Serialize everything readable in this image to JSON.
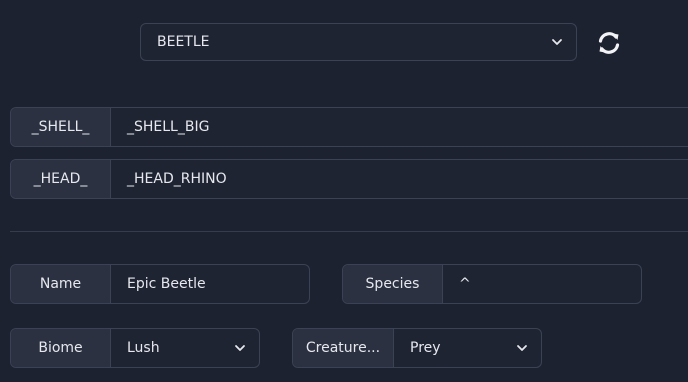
{
  "top_select": {
    "value": "BEETLE"
  },
  "parts": [
    {
      "label": "_SHELL_",
      "value": "_SHELL_BIG"
    },
    {
      "label": "_HEAD_",
      "value": "_HEAD_RHINO"
    }
  ],
  "name": {
    "label": "Name",
    "value": "Epic Beetle"
  },
  "species": {
    "label": "Species",
    "value": "^"
  },
  "biome": {
    "label": "Biome",
    "value": "Lush"
  },
  "creature_type": {
    "label": "Creature...",
    "value": "Prey"
  },
  "colors": {
    "background": "#1d2230",
    "addon": "#2b3141",
    "border": "#3b4254",
    "text": "#e6e8ee"
  },
  "icons": {
    "refresh": "refresh-icon",
    "dropdown": "chevron-down-icon"
  }
}
